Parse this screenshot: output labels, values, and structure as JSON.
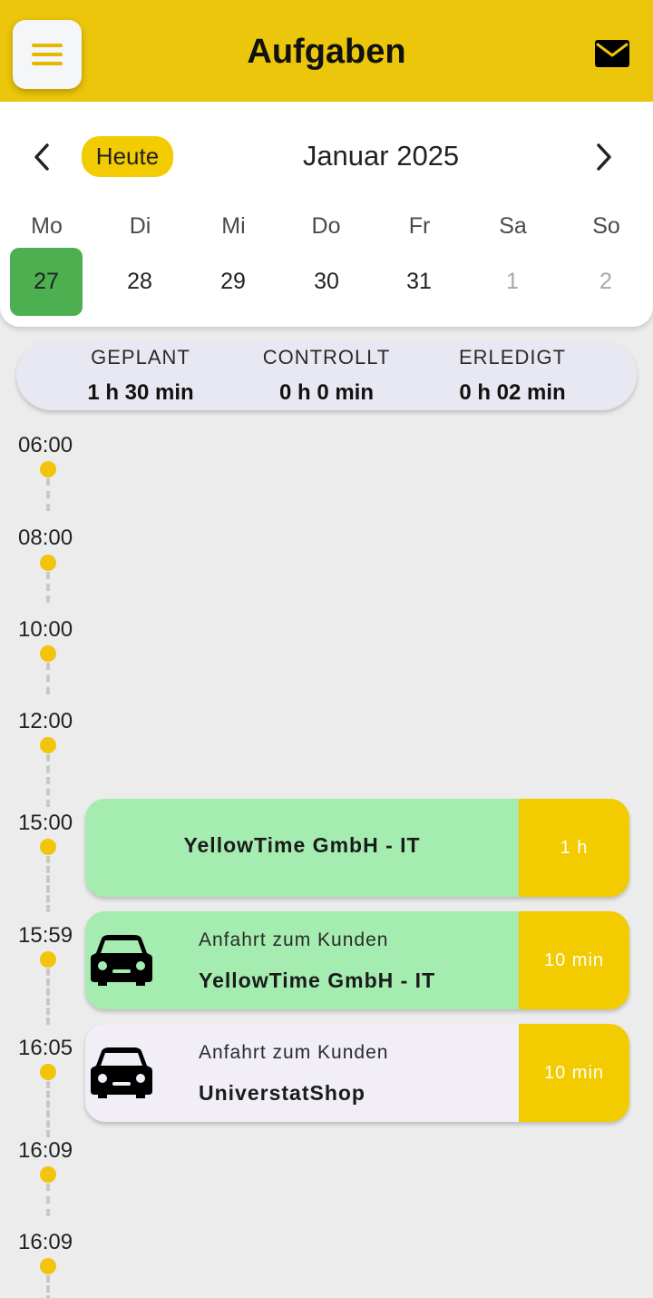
{
  "appbar": {
    "title": "Aufgaben",
    "menu_icon": "hamburger-icon",
    "mail_icon": "mail-icon"
  },
  "calendar": {
    "today_label": "Heute",
    "month_label": "Januar 2025",
    "weekdays": [
      "Mo",
      "Di",
      "Mi",
      "Do",
      "Fr",
      "Sa",
      "So"
    ],
    "days": [
      "27",
      "28",
      "29",
      "30",
      "31",
      "1",
      "2"
    ],
    "selected_color": "#4caf50"
  },
  "summary": {
    "planned_label": "GEPLANT",
    "planned_value": "1 h 30 min",
    "controlled_label": "CONTROLLT",
    "controlled_value": "0 h 0 min",
    "done_label": "ERLEDIGT",
    "done_value": "0 h 02 min"
  },
  "timeline": {
    "times": [
      "06:00",
      "08:00",
      "10:00",
      "12:00",
      "15:00",
      "15:59",
      "16:05",
      "16:09",
      "16:09"
    ],
    "tasks": [
      {
        "title": "YellowTime GmbH - IT",
        "duration": "1 h"
      },
      {
        "subtitle": "Anfahrt zum Kunden",
        "title": "YellowTime GmbH - IT",
        "duration": "10 min"
      },
      {
        "subtitle": "Anfahrt zum Kunden",
        "title": "UniverstatShop",
        "duration": "10 min"
      }
    ]
  },
  "colors": {
    "brand_yellow": "#ecc60a",
    "task_green": "#a5ecb0",
    "task_lavender": "#f1eef7",
    "accent_yellow": "#f2cb00"
  }
}
